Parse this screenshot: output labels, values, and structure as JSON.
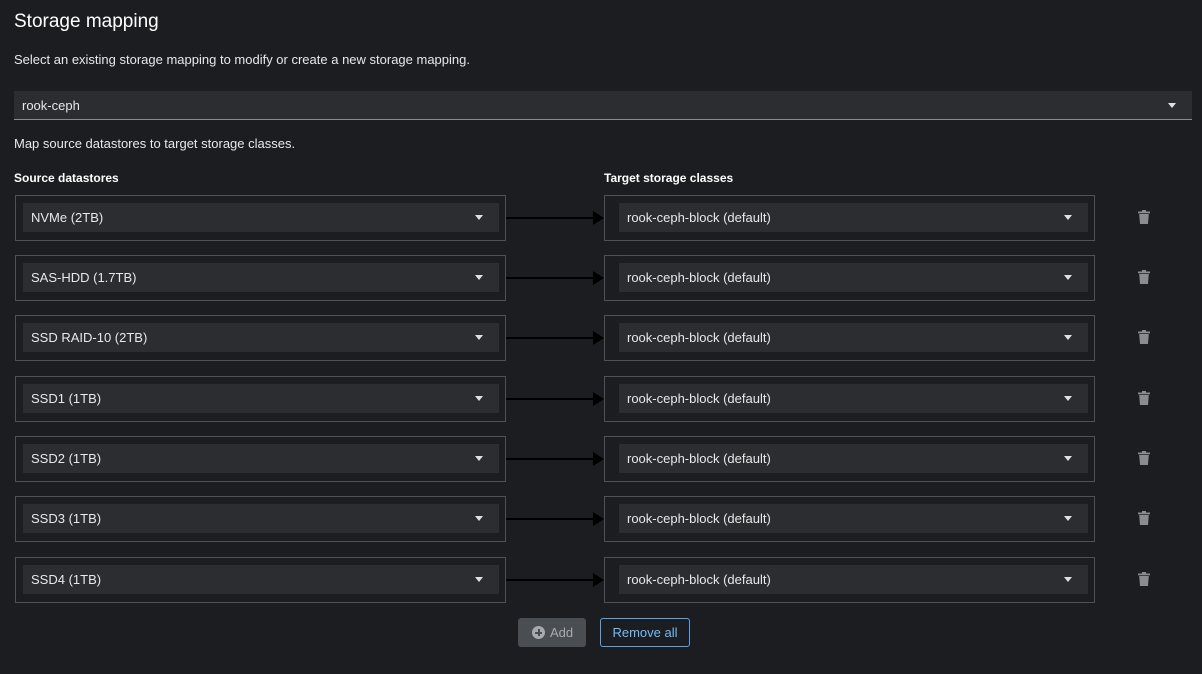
{
  "header": {
    "title": "Storage mapping",
    "description": "Select an existing storage mapping to modify or create a new storage mapping."
  },
  "mapping_select": {
    "value": "rook-ceph"
  },
  "mapping_description": "Map source datastores to target storage classes.",
  "columns": {
    "source": "Source datastores",
    "target": "Target storage classes"
  },
  "rows": [
    {
      "source": "NVMe (2TB)",
      "target": "rook-ceph-block (default)"
    },
    {
      "source": "SAS-HDD (1.7TB)",
      "target": "rook-ceph-block (default)"
    },
    {
      "source": "SSD RAID-10 (2TB)",
      "target": "rook-ceph-block (default)"
    },
    {
      "source": "SSD1 (1TB)",
      "target": "rook-ceph-block (default)"
    },
    {
      "source": "SSD2 (1TB)",
      "target": "rook-ceph-block (default)"
    },
    {
      "source": "SSD3 (1TB)",
      "target": "rook-ceph-block (default)"
    },
    {
      "source": "SSD4 (1TB)",
      "target": "rook-ceph-block (default)"
    }
  ],
  "actions": {
    "add_label": "Add",
    "remove_all_label": "Remove all"
  },
  "colors": {
    "background": "#1b1d21",
    "field": "#2b2d31",
    "link": "#73bcf7"
  },
  "icons": {
    "delete": "trash-icon",
    "add": "plus-circle-icon",
    "dropdown": "caret-down-icon"
  }
}
